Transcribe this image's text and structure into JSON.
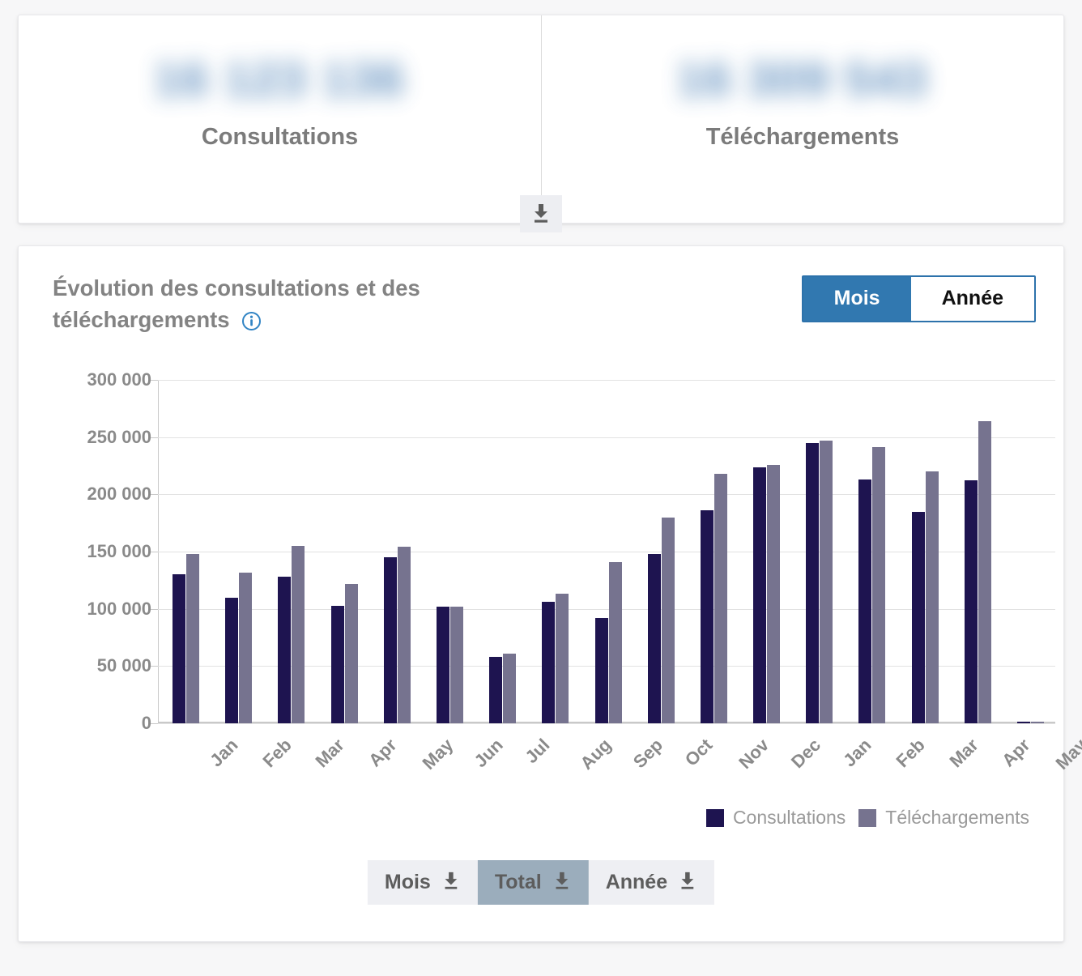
{
  "kpi": {
    "items": [
      {
        "value": "16 123 136",
        "label": "Consultations",
        "redacted": true
      },
      {
        "value": "16 309 543",
        "label": "Téléchargements",
        "redacted": true
      }
    ],
    "download_button_icon": "download-icon"
  },
  "chart_card": {
    "title": "Évolution des consultations et des téléchargements",
    "info_icon": "info-icon",
    "period_toggle": {
      "options": [
        {
          "label": "Mois",
          "active": true
        },
        {
          "label": "Année",
          "active": false
        }
      ],
      "active_color": "#3178b0",
      "border_color": "#2d72ab"
    },
    "download_buttons": [
      {
        "label": "Mois",
        "icon": "download-icon",
        "highlighted": false
      },
      {
        "label": "Total",
        "icon": "download-icon",
        "highlighted": true
      },
      {
        "label": "Année",
        "icon": "download-icon",
        "highlighted": false
      }
    ]
  },
  "chart_data": {
    "type": "bar",
    "title": "Évolution des consultations et des téléchargements",
    "xlabel": "",
    "ylabel": "",
    "ylim": [
      0,
      300000
    ],
    "yticks": [
      0,
      50000,
      100000,
      150000,
      200000,
      250000,
      300000
    ],
    "ytick_labels": [
      "0",
      "50 000",
      "100 000",
      "150 000",
      "200 000",
      "250 000",
      "300 000"
    ],
    "grid": true,
    "legend_position": "bottom-right",
    "categories": [
      "Jan",
      "Feb",
      "Mar",
      "Apr",
      "May",
      "Jun",
      "Jul",
      "Aug",
      "Sep",
      "Oct",
      "Nov",
      "Dec",
      "Jan",
      "Feb",
      "Mar",
      "Apr",
      "May"
    ],
    "series": [
      {
        "name": "Consultations",
        "color": "#1e1450",
        "values": [
          130000,
          110000,
          128000,
          103000,
          145000,
          102000,
          58000,
          106000,
          92000,
          148000,
          186000,
          224000,
          245000,
          213000,
          185000,
          212000,
          1500
        ]
      },
      {
        "name": "Téléchargements",
        "color": "#76738f",
        "values": [
          148000,
          132000,
          155000,
          122000,
          154000,
          102000,
          61000,
          113000,
          141000,
          180000,
          218000,
          226000,
          247000,
          241000,
          220000,
          264000,
          1800
        ]
      }
    ]
  }
}
